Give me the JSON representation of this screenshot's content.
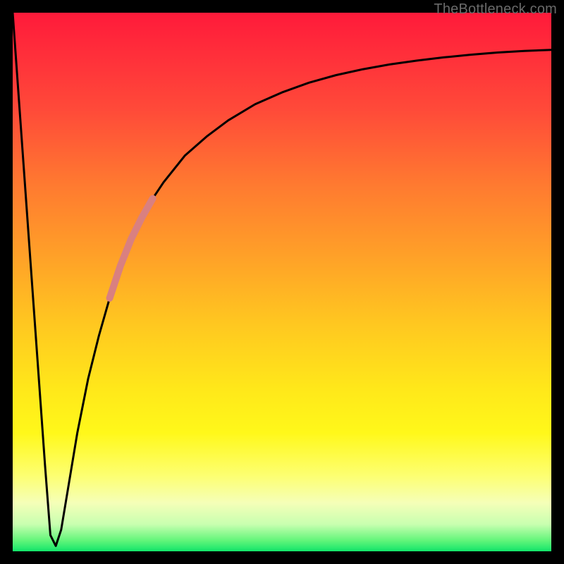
{
  "watermark": "TheBottleneck.com",
  "chart_data": {
    "type": "line",
    "title": "",
    "xlabel": "",
    "ylabel": "",
    "xlim": [
      0,
      100
    ],
    "ylim": [
      0,
      100
    ],
    "grid": false,
    "series": [
      {
        "name": "bottleneck-curve",
        "color": "#000000",
        "x": [
          0,
          2,
          4,
          6,
          7,
          8,
          9,
          10,
          12,
          14,
          16,
          18,
          20,
          22,
          24,
          26,
          28,
          32,
          36,
          40,
          45,
          50,
          55,
          60,
          65,
          70,
          75,
          80,
          85,
          90,
          95,
          100
        ],
        "y": [
          100,
          72,
          44,
          16,
          3,
          1,
          4,
          10,
          22,
          32,
          40,
          47,
          53,
          58,
          62,
          65.5,
          68.5,
          73.5,
          77,
          80,
          83,
          85.2,
          87,
          88.4,
          89.5,
          90.4,
          91.1,
          91.7,
          92.2,
          92.6,
          92.9,
          93.1
        ]
      },
      {
        "name": "highlight-segment",
        "color": "#d98080",
        "x": [
          18,
          20,
          22,
          24,
          26
        ],
        "y": [
          47,
          53,
          58,
          62,
          65.5
        ]
      }
    ]
  }
}
